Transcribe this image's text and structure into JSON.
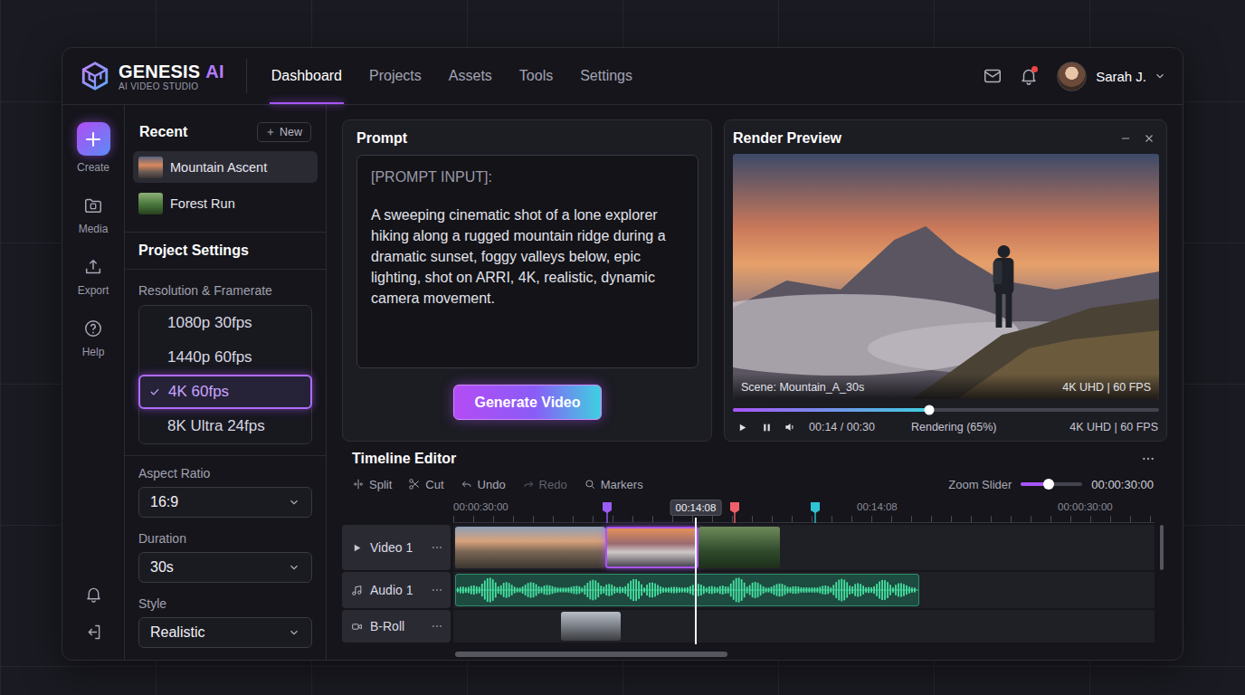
{
  "brand": {
    "name": "GENESIS",
    "accent": "AI",
    "subtitle": "AI VIDEO STUDIO"
  },
  "nav": [
    {
      "label": "Dashboard",
      "selected": true
    },
    {
      "label": "Projects",
      "selected": false
    },
    {
      "label": "Assets",
      "selected": false
    },
    {
      "label": "Tools",
      "selected": false
    },
    {
      "label": "Settings",
      "selected": false
    }
  ],
  "user": {
    "name": "Sarah J.",
    "unread_notifications": true
  },
  "rail": [
    {
      "label": "Create",
      "selected": true
    },
    {
      "label": "Media",
      "selected": false
    },
    {
      "label": "Export",
      "selected": false
    },
    {
      "label": "Help",
      "selected": false
    }
  ],
  "recent": {
    "title": "Recent",
    "new_button": "New",
    "items": [
      {
        "label": "Mountain Ascent",
        "selected": true
      },
      {
        "label": "Forest Run",
        "selected": false
      }
    ]
  },
  "project_settings": {
    "title": "Project Settings",
    "resolution": {
      "label": "Resolution & Framerate",
      "options": [
        {
          "label": "1080p 30fps",
          "selected": false
        },
        {
          "label": "1440p 60fps",
          "selected": false
        },
        {
          "label": "4K 60fps",
          "selected": true
        },
        {
          "label": "8K Ultra 24fps",
          "selected": false
        }
      ]
    },
    "aspect_ratio": {
      "label": "Aspect Ratio",
      "value": "16:9"
    },
    "duration": {
      "label": "Duration",
      "value": "30s"
    },
    "style": {
      "label": "Style",
      "value": "Realistic"
    }
  },
  "prompt": {
    "title": "Prompt",
    "label": "[PROMPT INPUT]:",
    "text": "A sweeping cinematic shot of a lone explorer hiking along a rugged mountain ridge during a dramatic sunset, foggy valleys below, epic lighting, shot on ARRI, 4K, realistic, dynamic camera movement.",
    "button": "Generate Video"
  },
  "preview": {
    "title": "Render Preview",
    "scene": "Scene: Mountain_A_30s",
    "overlay_format": "4K UHD | 60 FPS",
    "level": 0.46,
    "time": "00:14 / 00:30",
    "status": "Rendering (65%)",
    "format": "4K UHD | 60 FPS"
  },
  "timeline": {
    "title": "Timeline Editor",
    "tools": [
      {
        "label": "Split",
        "disabled": false
      },
      {
        "label": "Cut",
        "disabled": false
      },
      {
        "label": "Undo",
        "disabled": false
      },
      {
        "label": "Redo",
        "disabled": true
      },
      {
        "label": "Markers",
        "disabled": false
      }
    ],
    "zoom": {
      "label": "Zoom Slider",
      "level": 0.45,
      "time": "00:00:30:00"
    },
    "ruler": [
      "00:00:30:00",
      "00:14:08",
      "00:00:30:00"
    ],
    "playhead": "00:14:08",
    "markers": [
      {
        "color": "#9b5cf6"
      },
      {
        "color": "#f0606a"
      },
      {
        "color": "#2ec4d6"
      }
    ],
    "tracks": [
      {
        "name": "Video 1",
        "kind": "video",
        "clips": [
          {
            "selected": false
          },
          {
            "selected": true
          },
          {
            "selected": false
          }
        ]
      },
      {
        "name": "Audio 1",
        "kind": "audio",
        "clips": [
          {
            "selected": false
          }
        ]
      },
      {
        "name": "B-Roll",
        "kind": "broll",
        "clips": [
          {
            "selected": false
          }
        ]
      }
    ]
  }
}
